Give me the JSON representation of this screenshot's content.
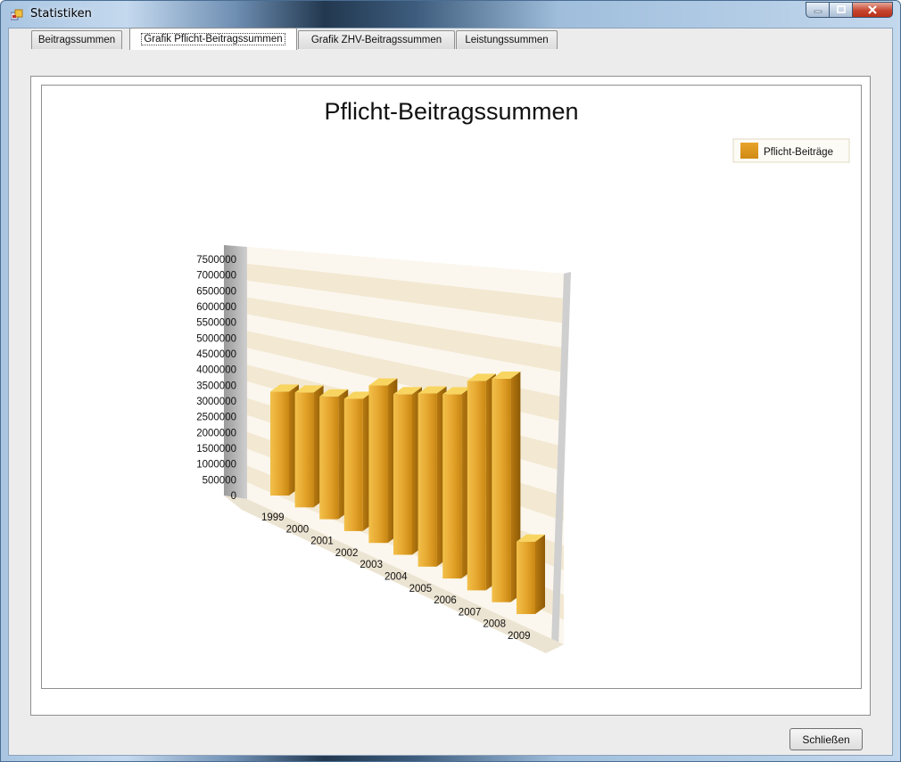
{
  "window": {
    "title": "Statistiken",
    "accent": "#4a6d92",
    "close_button_color": "#c7452f"
  },
  "tabs": [
    {
      "label": "Beitragssummen",
      "selected": false
    },
    {
      "label": "Grafik Pflicht-Beitragssummen",
      "selected": true
    },
    {
      "label": "Grafik ZHV-Beitragssummen",
      "selected": false
    },
    {
      "label": "Leistungssummen",
      "selected": false
    }
  ],
  "footer": {
    "close_label": "Schließen"
  },
  "chart_data": {
    "type": "bar",
    "title": "Pflicht-Beitragssummen",
    "bar_color": "#e1a02a",
    "legend_position": "top-right",
    "grid": true,
    "categories": [
      "1999",
      "2000",
      "2001",
      "2002",
      "2003",
      "2004",
      "2005",
      "2006",
      "2007",
      "2008",
      "2009"
    ],
    "y_ticks": [
      "0",
      "500000",
      "1000000",
      "1500000",
      "2000000",
      "2500000",
      "3000000",
      "3500000",
      "4000000",
      "4500000",
      "5000000",
      "5500000",
      "6000000",
      "6500000",
      "7000000",
      "7500000"
    ],
    "ylim": [
      0,
      7500000
    ],
    "series": [
      {
        "name": "Pflicht-Beiträge",
        "values": [
          3300000,
          3650000,
          3900000,
          4200000,
          5000000,
          5100000,
          5500000,
          5850000,
          6650000,
          7100000,
          2300000
        ]
      }
    ]
  }
}
